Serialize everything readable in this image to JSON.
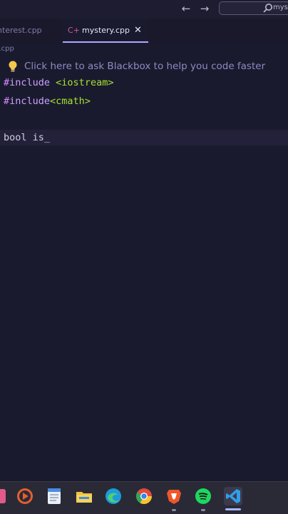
{
  "titlebar": {
    "back_arrow": "←",
    "forward_arrow": "→",
    "search_text": "mys"
  },
  "tabs": [
    {
      "label": "nterest.cpp",
      "active": false
    },
    {
      "label": "mystery.cpp",
      "active": true,
      "icon": "C++",
      "close": "✕"
    }
  ],
  "breadcrumb": "y.cpp",
  "hint": {
    "text": "Click here to ask Blackbox to help you code faster"
  },
  "code": {
    "line1_hash": "#",
    "line1_kw": "include",
    "line1_rest": " <iostream>",
    "line2_hash": "#",
    "line2_kw": "include",
    "line2_rest": "<cmath>",
    "line4": "bool is_"
  },
  "taskbar": {
    "icons": [
      "media-player-icon",
      "notepad-icon",
      "file-explorer-icon",
      "edge-icon",
      "chrome-icon",
      "brave-icon",
      "spotify-icon",
      "vscode-icon"
    ]
  },
  "colors": {
    "accent": "#b3a5ff",
    "background": "#1a1a2e",
    "string": "#a6e22e"
  }
}
